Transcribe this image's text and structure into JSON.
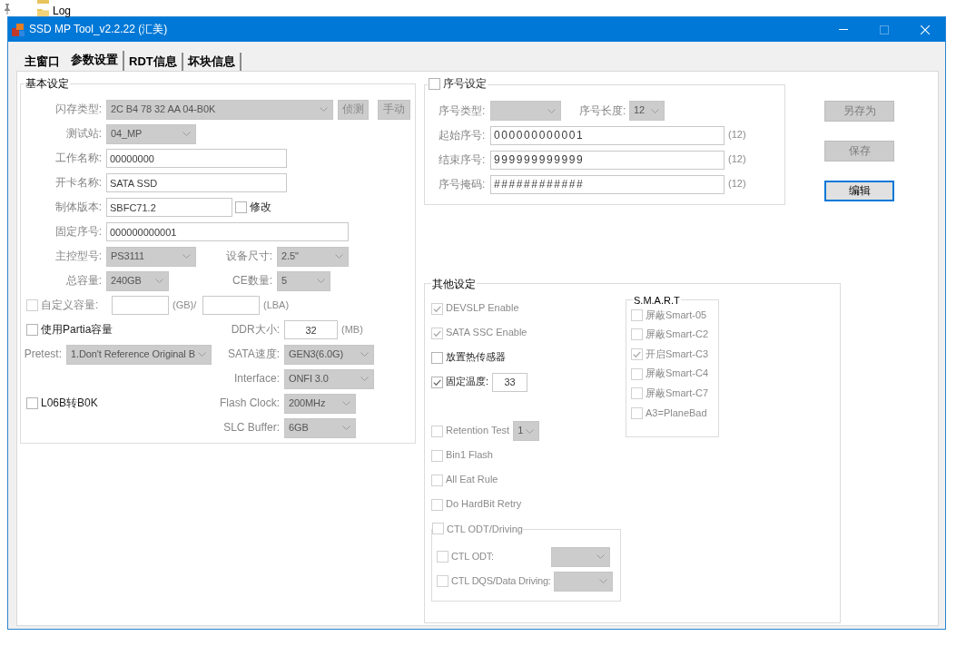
{
  "explorer": {
    "items": [
      {
        "label": "Log"
      }
    ]
  },
  "window": {
    "title": "SSD MP Tool_v2.2.22 (汇美)"
  },
  "tabs": [
    {
      "label": "主窗口",
      "selected": false
    },
    {
      "label": "参数设置",
      "selected": true
    },
    {
      "label": "RDT信息",
      "selected": false
    },
    {
      "label": "坏块信息",
      "selected": false
    }
  ],
  "basic_settings": {
    "title": "基本设定",
    "rows": [
      {
        "items": [
          {
            "kind": "label",
            "text": "闪存类型:"
          },
          {
            "kind": "combo",
            "value": "2C B4 78 32 AA 04-B0K"
          },
          {
            "kind": "button",
            "label": "侦测",
            "disabled": true
          },
          {
            "kind": "button",
            "label": "手动",
            "disabled": true
          }
        ]
      },
      {
        "items": [
          {
            "kind": "label",
            "text": "测试站:"
          },
          {
            "kind": "combo",
            "value": "04_MP"
          }
        ]
      },
      {
        "items": [
          {
            "kind": "label",
            "text": "工作名称:"
          },
          {
            "kind": "input",
            "value": "00000000"
          }
        ]
      },
      {
        "items": [
          {
            "kind": "label",
            "text": "开卡名称:"
          },
          {
            "kind": "input",
            "value": "SATA SSD"
          }
        ]
      },
      {
        "items": [
          {
            "kind": "label",
            "text": "制体版本:"
          },
          {
            "kind": "input",
            "value": "SBFC71.2"
          },
          {
            "kind": "checkbox",
            "label": "修改",
            "checked": false,
            "disabled": false
          }
        ]
      },
      {
        "items": [
          {
            "kind": "label",
            "text": "固定序号:"
          },
          {
            "kind": "input",
            "value": "000000000001"
          }
        ]
      },
      {
        "items": [
          {
            "kind": "label",
            "text": "主控型号:"
          },
          {
            "kind": "combo",
            "value": "PS3111"
          },
          {
            "kind": "label",
            "text": "设备尺寸:"
          },
          {
            "kind": "combo",
            "value": "2.5\""
          }
        ]
      },
      {
        "items": [
          {
            "kind": "label",
            "text": "总容量:"
          },
          {
            "kind": "combo",
            "value": "240GB"
          },
          {
            "kind": "label",
            "text": "CE数量:"
          },
          {
            "kind": "combo",
            "value": "5"
          }
        ]
      },
      {
        "items": [
          {
            "kind": "checkbox",
            "label": "自定义容量:",
            "checked": false,
            "disabled": true
          },
          {
            "kind": "input"
          },
          {
            "kind": "unit",
            "text": "(GB)/"
          },
          {
            "kind": "input"
          },
          {
            "kind": "unit",
            "text": "(LBA)"
          }
        ]
      },
      {
        "items": [
          {
            "kind": "checkbox",
            "label": "使用Partia容量",
            "checked": false,
            "disabled": false
          },
          {
            "kind": "label",
            "text": "DDR大小:"
          },
          {
            "kind": "input",
            "value": "32"
          },
          {
            "kind": "unit",
            "text": "(MB)"
          }
        ]
      },
      {
        "items": [
          {
            "kind": "label",
            "text": "Pretest:"
          },
          {
            "kind": "combo",
            "value": "1.Don't Reference Original B"
          },
          {
            "kind": "label",
            "text": "SATA速度:"
          },
          {
            "kind": "combo",
            "value": "GEN3(6.0G)"
          }
        ]
      },
      {
        "items": [
          {
            "kind": "label",
            "text": "Interface:"
          },
          {
            "kind": "combo",
            "value": "ONFI 3.0"
          }
        ]
      },
      {
        "items": [
          {
            "kind": "checkbox",
            "label": "L06B转B0K",
            "checked": false,
            "disabled": false
          },
          {
            "kind": "label",
            "text": "Flash Clock:"
          },
          {
            "kind": "combo",
            "value": "200MHz"
          }
        ]
      },
      {
        "items": [
          {
            "kind": "label",
            "text": "SLC Buffer:"
          },
          {
            "kind": "combo",
            "value": "6GB"
          }
        ]
      }
    ]
  },
  "serial_settings": {
    "title": "序号设定",
    "checked": false,
    "rows": [
      {
        "items": [
          {
            "kind": "label",
            "text": "序号类型:"
          },
          {
            "kind": "combo"
          },
          {
            "kind": "label",
            "text": "序号长度:"
          },
          {
            "kind": "combo",
            "value": "12"
          }
        ]
      },
      {
        "items": [
          {
            "kind": "label",
            "text": "起始序号:"
          },
          {
            "kind": "input",
            "value": "000000000001"
          },
          {
            "kind": "unit",
            "text": "(12)"
          }
        ]
      },
      {
        "items": [
          {
            "kind": "label",
            "text": "结束序号:"
          },
          {
            "kind": "input",
            "value": "999999999999"
          },
          {
            "kind": "unit",
            "text": "(12)"
          }
        ]
      },
      {
        "items": [
          {
            "kind": "label",
            "text": "序号掩码:"
          },
          {
            "kind": "input",
            "value": "############"
          },
          {
            "kind": "unit",
            "text": "(12)"
          }
        ]
      }
    ]
  },
  "side_buttons": [
    {
      "label": "另存为",
      "disabled": true,
      "focused": false
    },
    {
      "label": "保存",
      "disabled": true,
      "focused": false
    },
    {
      "label": "编辑",
      "disabled": false,
      "focused": true
    }
  ],
  "other_settings": {
    "title": "其他设定",
    "options": [
      {
        "kind": "checkbox",
        "label": "DEVSLP Enable",
        "checked": true,
        "disabled": true
      },
      {
        "kind": "checkbox",
        "label": "SATA SSC Enable",
        "checked": true,
        "disabled": true
      },
      {
        "kind": "checkbox",
        "label": "放置热传感器",
        "checked": false,
        "disabled": false
      },
      {
        "kind": "checkbox_input",
        "label": "固定温度:",
        "checked": true,
        "disabled": false,
        "value": "33"
      },
      {
        "kind": "checkbox_combo",
        "label": "Retention Test",
        "checked": false,
        "disabled": true,
        "value": "1"
      },
      {
        "kind": "checkbox",
        "label": "Bin1 Flash",
        "checked": false,
        "disabled": true
      },
      {
        "kind": "checkbox",
        "label": "All Eat Rule",
        "checked": false,
        "disabled": true
      },
      {
        "kind": "checkbox",
        "label": "Do HardBit Retry",
        "checked": false,
        "disabled": true
      },
      {
        "kind": "checkbox_group",
        "label": "CTL ODT/Driving",
        "checked": false,
        "disabled": true,
        "options": [
          {
            "kind": "checkbox_combo",
            "label": "CTL ODT:",
            "checked": false,
            "disabled": true
          },
          {
            "kind": "checkbox_combo",
            "label": "CTL DQS/Data Driving:",
            "checked": false,
            "disabled": true
          }
        ]
      }
    ],
    "smart": {
      "title": "S.M.A.R.T",
      "options": [
        {
          "label": "屏蔽Smart-05",
          "checked": false,
          "disabled": true
        },
        {
          "label": "屏蔽Smart-C2",
          "checked": false,
          "disabled": true
        },
        {
          "label": "开启Smart-C3",
          "checked": true,
          "disabled": true
        },
        {
          "label": "屏蔽Smart-C4",
          "checked": false,
          "disabled": true
        },
        {
          "label": "屏蔽Smart-C7",
          "checked": false,
          "disabled": true
        },
        {
          "label": "A3=PlaneBad",
          "checked": false,
          "disabled": true
        }
      ]
    }
  }
}
